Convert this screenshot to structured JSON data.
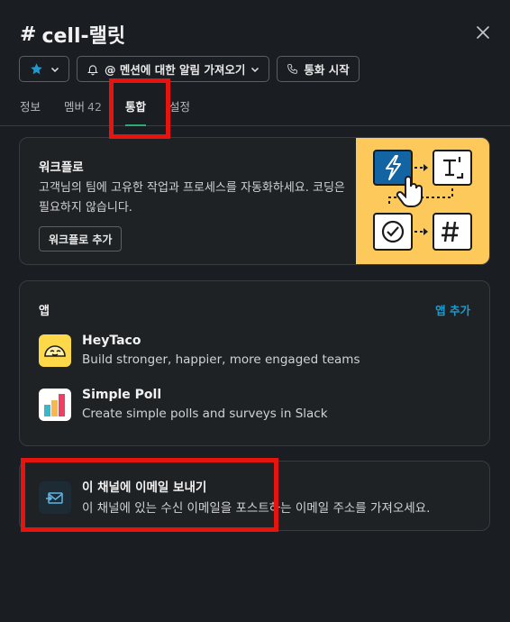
{
  "header": {
    "channel_hash": "#",
    "channel_name": "cell-랠릿",
    "notify_label": "@ 멘션에 대한 알림 가져오기",
    "call_label": "통화 시작"
  },
  "tabs": [
    {
      "label": "정보"
    },
    {
      "label": "멤버",
      "count": "42"
    },
    {
      "label": "통합"
    },
    {
      "label": "설정"
    }
  ],
  "workflow": {
    "title": "워크플로",
    "description": "고객님의 팀에 고유한 작업과 프로세스를 자동화하세요. 코딩은 필요하지 않습니다.",
    "button": "워크플로 추가"
  },
  "apps": {
    "heading": "앱",
    "add_label": "앱 추가",
    "items": [
      {
        "name": "HeyTaco",
        "description": "Build stronger, happier, more engaged teams",
        "icon": "taco-icon"
      },
      {
        "name": "Simple Poll",
        "description": "Create simple polls and surveys in Slack",
        "icon": "poll-icon"
      }
    ]
  },
  "email": {
    "title": "이 채널에 이메일 보내기",
    "description": "이 채널에 있는 수신 이메일을 포스트하는 이메일 주소를 가져오세요.",
    "icon": "mail-arrow-icon"
  },
  "colors": {
    "accent": "#1d9bd1",
    "active_tab": "#2bac76",
    "highlight": "#e6140e",
    "workflow_bg": "#fcc95a"
  }
}
